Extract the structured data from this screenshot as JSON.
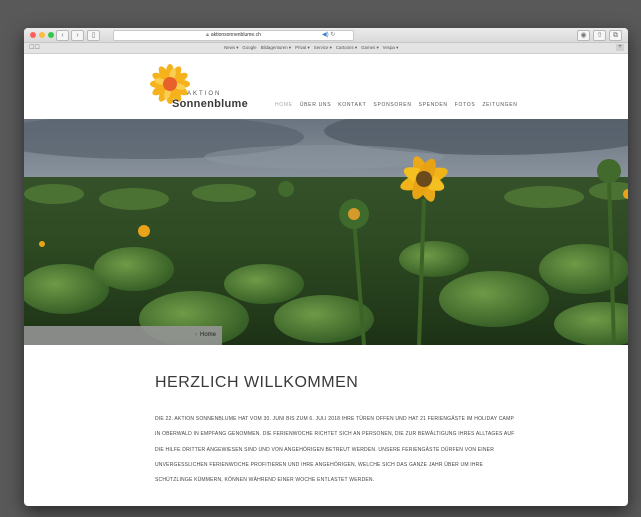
{
  "browser": {
    "url": "aktionsonnenblume.ch",
    "bookmarks": [
      "News ▾",
      "Google",
      "Bildagenturen ▾",
      "Privat ▾",
      "Service ▾",
      "Cartoons ▾",
      "Games ▾",
      "Vespa ▾"
    ],
    "colors": {
      "close": "#fc605c",
      "minimize": "#fdbc40",
      "zoom": "#34c84a"
    }
  },
  "site": {
    "brand_top": "AKTION",
    "brand_name": "Sonnenblume",
    "nav": [
      "HOME",
      "ÜBER UNS",
      "KONTAKT",
      "SPONSOREN",
      "SPENDEN",
      "FOTOS",
      "ZEITUNGEN"
    ],
    "active_nav": "HOME",
    "breadcrumb": "Home",
    "title": "HERZLICH WILLKOMMEN",
    "intro": "DIE 22. AKTION SONNENBLUME HAT VOM 30. JUNI BIS ZUM 6. JULI 2018 IHRE TÜREN OFFEN UND HAT 21 FERIENGÄSTE IM HOLIDAY CAMP IN OBERWALD IN EMPFANG GENOMMEN. DIE FERIENWOCHE RICHTET SICH AN PERSONEN, DIE ZUR BEWÄLTIGUNG IHRES ALLTAGES AUF DIE HILFE DRITTER ANGEWIESEN SIND UND VON ANGEHÖRIGEN BETREUT WERDEN. UNSERE FERIENGÄSTE DÜRFEN VON EINER UNVERGESSLICHEN FERIENWOCHE PROFITIEREN UND IHRE ANGEHÖRIGEN, WELCHE SICH DAS GANZE JAHR ÜBER UM IHRE SCHÜTZLINGE KÜMMERN, KÖNNEN WÄHREND EINER WOCHE ENTLASTET WERDEN."
  }
}
